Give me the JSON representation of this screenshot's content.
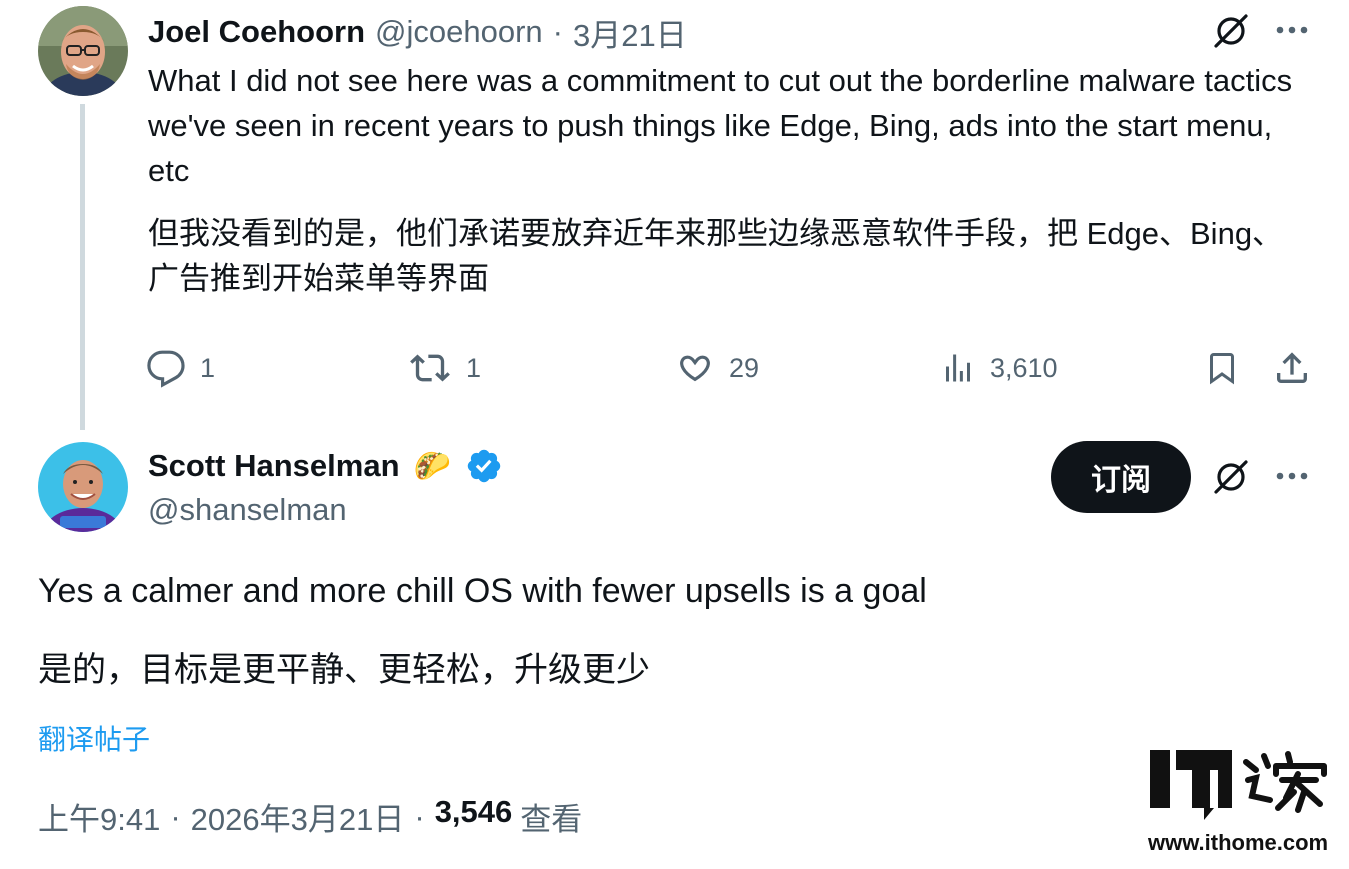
{
  "reply": {
    "author_name": "Joel Coehoorn",
    "handle": "@jcoehoorn",
    "separator": "·",
    "date": "3月21日",
    "text_en": "What I did not see here was a commitment to cut out the borderline malware tactics we've seen in recent years to push things like Edge, Bing, ads into the start menu, etc",
    "text_zh": "但我没看到的是，他们承诺要放弃近年来那些边缘恶意软件手段，把 Edge、Bing、广告推到开始菜单等界面",
    "actions": {
      "replies": "1",
      "retweets": "1",
      "likes": "29",
      "views": "3,610"
    }
  },
  "main_tweet": {
    "author_name": "Scott Hanselman",
    "emoji": "🌮",
    "handle": "@shanselman",
    "subscribe_label": "订阅",
    "text_en": "Yes a calmer and more chill OS with fewer upsells is a goal",
    "text_zh": "是的，目标是更平静、更轻松，升级更少",
    "translate_label": "翻译帖子",
    "time": "上午9:41",
    "dot": "·",
    "full_date": "2026年3月21日",
    "view_count": "3,546",
    "view_label": "查看"
  },
  "watermark": {
    "logo_text": "IT之家",
    "url": "www.ithome.com"
  },
  "colors": {
    "text": "#0f1419",
    "muted": "#536471",
    "link": "#1d9bf0",
    "verified": "#1d9bf0",
    "button_bg": "#0f1419"
  }
}
